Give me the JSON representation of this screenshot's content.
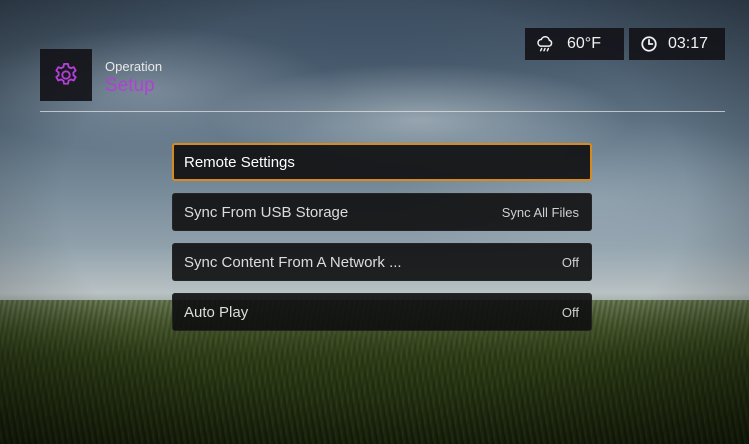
{
  "header": {
    "section": "Operation",
    "title": "Setup",
    "title_color": "#b23fd6",
    "icon": "gear-icon"
  },
  "status": {
    "weather_icon": "cloud-rain-icon",
    "temperature": "60°F",
    "clock_icon": "clock-icon",
    "time": "03:17"
  },
  "menu": {
    "selected_border_color": "#d98a1f",
    "items": [
      {
        "label": "Remote Settings",
        "value": "",
        "selected": true
      },
      {
        "label": "Sync From USB Storage",
        "value": "Sync All Files",
        "selected": false
      },
      {
        "label": "Sync Content From A Network ...",
        "value": "Off",
        "selected": false
      },
      {
        "label": "Auto Play",
        "value": "Off",
        "selected": false
      }
    ]
  }
}
